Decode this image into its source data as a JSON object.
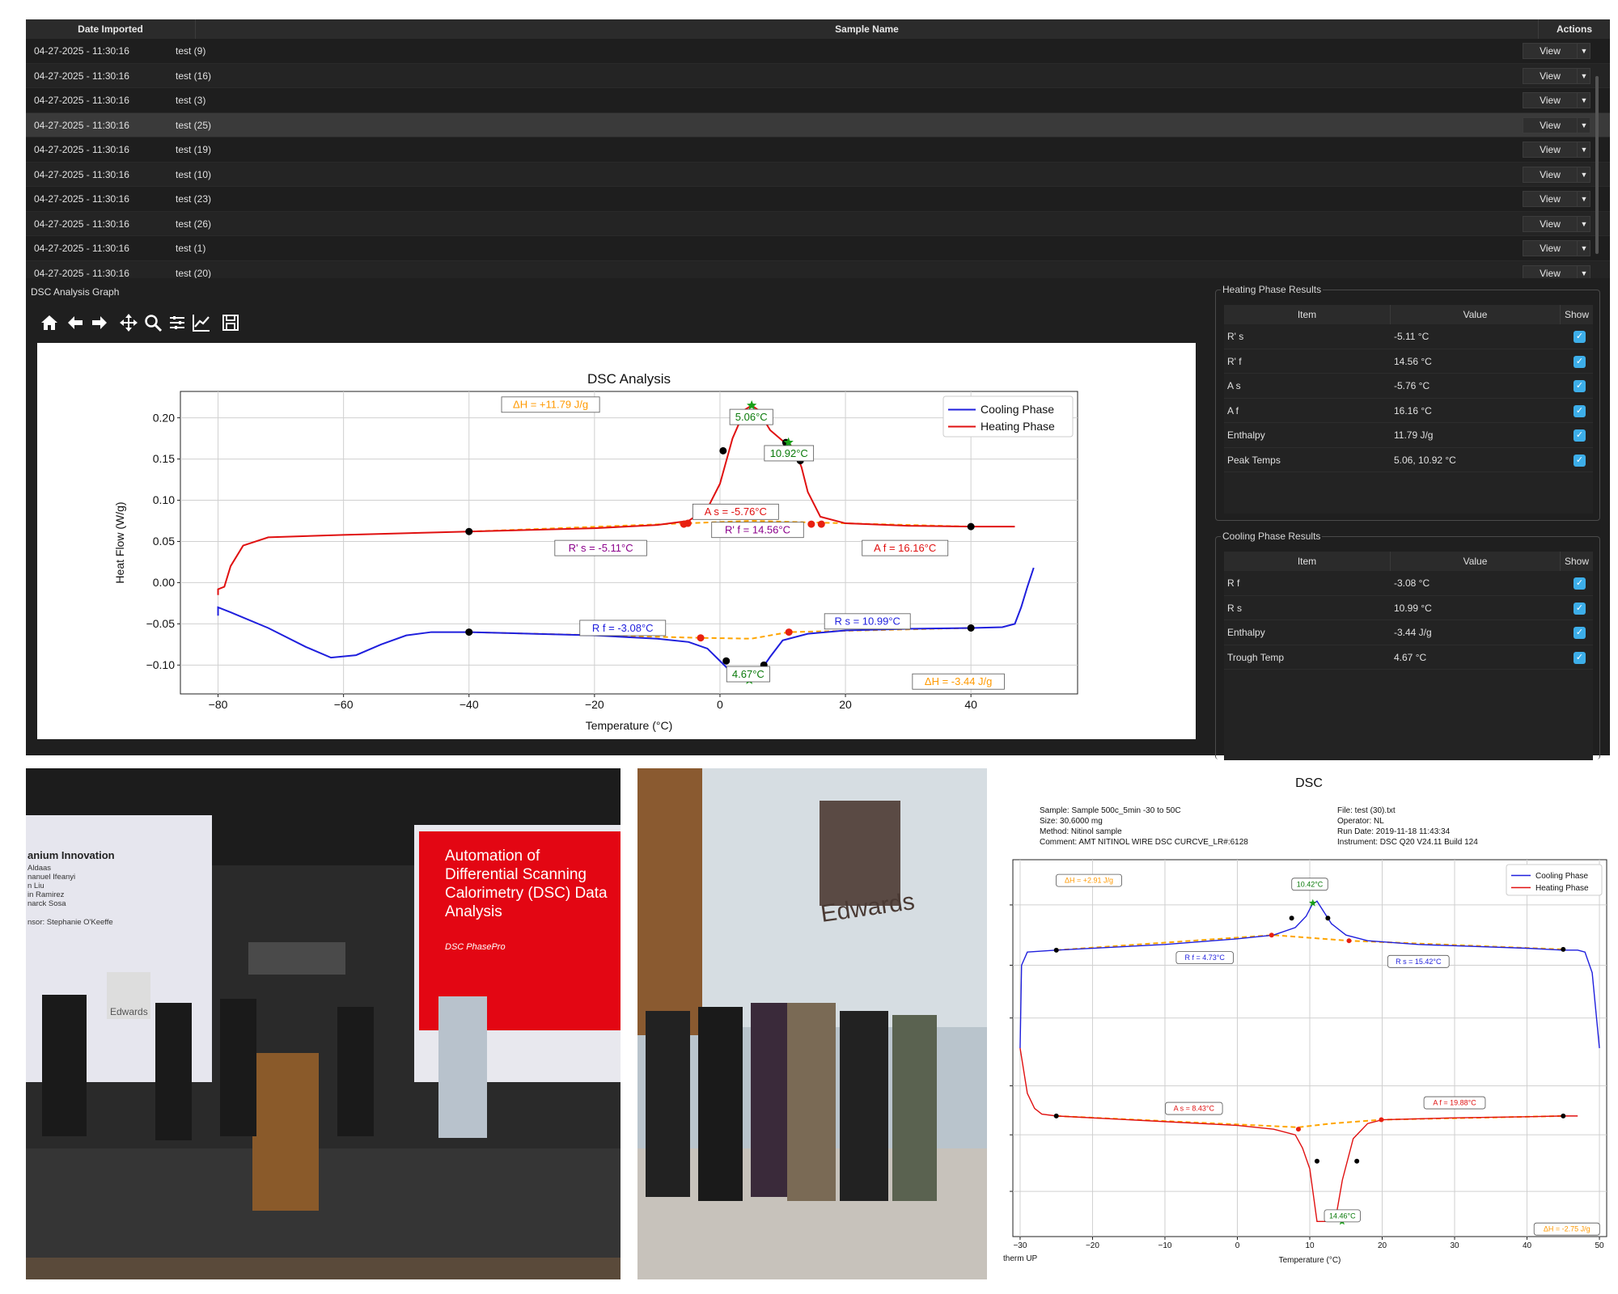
{
  "table": {
    "headers": [
      "Date Imported",
      "Sample Name",
      "Actions"
    ],
    "rows": [
      {
        "date": "04-27-2025 - 11:30:16",
        "name": "test (9)",
        "action": "View"
      },
      {
        "date": "04-27-2025 - 11:30:16",
        "name": "test (16)",
        "action": "View"
      },
      {
        "date": "04-27-2025 - 11:30:16",
        "name": "test (3)",
        "action": "View"
      },
      {
        "date": "04-27-2025 - 11:30:16",
        "name": "test (25)",
        "action": "View"
      },
      {
        "date": "04-27-2025 - 11:30:16",
        "name": "test (19)",
        "action": "View"
      },
      {
        "date": "04-27-2025 - 11:30:16",
        "name": "test (10)",
        "action": "View"
      },
      {
        "date": "04-27-2025 - 11:30:16",
        "name": "test (23)",
        "action": "View"
      },
      {
        "date": "04-27-2025 - 11:30:16",
        "name": "test (26)",
        "action": "View"
      },
      {
        "date": "04-27-2025 - 11:30:16",
        "name": "test (1)",
        "action": "View"
      },
      {
        "date": "04-27-2025 - 11:30:16",
        "name": "test (20)",
        "action": "View"
      }
    ],
    "selected_row": "test (25)"
  },
  "graph_panel_title": "DSC Analysis Graph",
  "toolbar": [
    "home-icon",
    "back-icon",
    "forward-icon",
    "pan-icon",
    "zoom-icon",
    "configure-subplots-icon",
    "edit-axis-icon",
    "save-icon"
  ],
  "heating_results": {
    "title": "Heating Phase Results",
    "headers": [
      "Item",
      "Value",
      "Show"
    ],
    "rows": [
      {
        "item": "R' s",
        "value": "-5.11 °C"
      },
      {
        "item": "R' f",
        "value": "14.56 °C"
      },
      {
        "item": "A s",
        "value": "-5.76 °C"
      },
      {
        "item": "A f",
        "value": "16.16 °C"
      },
      {
        "item": "Enthalpy",
        "value": "11.79 J/g"
      },
      {
        "item": "Peak Temps",
        "value": "5.06, 10.92 °C"
      }
    ]
  },
  "cooling_results": {
    "title": "Cooling Phase Results",
    "headers": [
      "Item",
      "Value",
      "Show"
    ],
    "rows": [
      {
        "item": "R f",
        "value": "-3.08 °C"
      },
      {
        "item": "R s",
        "value": "10.99 °C"
      },
      {
        "item": "Enthalpy",
        "value": "-3.44 J/g"
      },
      {
        "item": "Trough Temp",
        "value": "4.67 °C"
      }
    ]
  },
  "chart_data": [
    {
      "type": "line",
      "title": "DSC Analysis",
      "xlabel": "Temperature (°C)",
      "ylabel": "Heat Flow (W/g)",
      "xlim": [
        -86,
        57
      ],
      "ylim": [
        -0.135,
        0.232
      ],
      "xticks": [
        -80,
        -60,
        -40,
        -20,
        0,
        20,
        40
      ],
      "yticks": [
        0.2,
        0.15,
        0.1,
        0.05,
        0.0,
        -0.05,
        -0.1
      ],
      "ytick_labels": [
        "0.20",
        "0.15",
        "0.10",
        "0.05",
        "0.00",
        "−0.05",
        "−0.10"
      ],
      "xtick_labels": [
        "−80",
        "−60",
        "−40",
        "−20",
        "0",
        "20",
        "40"
      ],
      "grid": true,
      "legend_position": "top-right",
      "series": [
        {
          "name": "Cooling Phase",
          "color": "#1f1fdd",
          "x": [
            -80,
            -80,
            -78,
            -72,
            -66,
            -62,
            -58,
            -54,
            -50,
            -46,
            -40,
            -30,
            -20,
            -10,
            -5,
            -2,
            0,
            2,
            4,
            4.67,
            6,
            8,
            10,
            14,
            20,
            30,
            40,
            45,
            47,
            48,
            49,
            50
          ],
          "y": [
            -0.04,
            -0.03,
            -0.036,
            -0.055,
            -0.078,
            -0.091,
            -0.088,
            -0.075,
            -0.064,
            -0.06,
            -0.06,
            -0.062,
            -0.064,
            -0.068,
            -0.072,
            -0.08,
            -0.095,
            -0.11,
            -0.117,
            -0.118,
            -0.112,
            -0.09,
            -0.07,
            -0.062,
            -0.058,
            -0.056,
            -0.055,
            -0.054,
            -0.05,
            -0.03,
            -0.005,
            0.018
          ]
        },
        {
          "name": "Heating Phase",
          "color": "#e01010",
          "x": [
            -80,
            -80,
            -79,
            -78,
            -76,
            -72,
            -60,
            -40,
            -20,
            -10,
            -5,
            -2,
            0,
            2,
            4,
            5.06,
            6,
            8,
            10,
            10.92,
            12,
            13,
            14,
            16,
            20,
            30,
            40,
            47
          ],
          "y": [
            -0.015,
            -0.008,
            -0.005,
            0.02,
            0.045,
            0.055,
            0.058,
            0.062,
            0.066,
            0.07,
            0.075,
            0.09,
            0.12,
            0.175,
            0.21,
            0.215,
            0.21,
            0.185,
            0.172,
            0.17,
            0.16,
            0.14,
            0.11,
            0.08,
            0.072,
            0.069,
            0.068,
            0.068
          ]
        }
      ],
      "baselines": [
        {
          "x": [
            -40,
            5,
            40
          ],
          "y": [
            0.062,
            0.075,
            0.068
          ],
          "color": "#ffa500"
        },
        {
          "x": [
            -40,
            -3.08,
            5,
            10.99,
            40
          ],
          "y": [
            -0.06,
            -0.067,
            -0.068,
            -0.06,
            -0.055
          ],
          "color": "#ffa500"
        }
      ],
      "markers_black": [
        [
          -40,
          0.062
        ],
        [
          40,
          0.068
        ],
        [
          0.5,
          0.16
        ],
        [
          12.8,
          0.148
        ],
        [
          10.5,
          0.17
        ],
        [
          -40,
          -0.06
        ],
        [
          40,
          -0.055
        ],
        [
          1,
          -0.095
        ],
        [
          7,
          -0.1
        ]
      ],
      "markers_red": [
        [
          -5.76,
          0.071
        ],
        [
          -5.11,
          0.072
        ],
        [
          14.56,
          0.071
        ],
        [
          16.16,
          0.071
        ],
        [
          -3.08,
          -0.067
        ],
        [
          10.99,
          -0.06
        ]
      ],
      "markers_green": [
        [
          5.06,
          0.215
        ],
        [
          10.92,
          0.17
        ],
        [
          4.67,
          -0.118
        ]
      ],
      "annotations": [
        {
          "text": "ΔH = +11.79 J/g",
          "x": -27,
          "y": 0.216,
          "color": "#ff9900"
        },
        {
          "text": "5.06°C",
          "x": 5,
          "y": 0.201,
          "color": "#0a7a0a"
        },
        {
          "text": "10.92°C",
          "x": 11,
          "y": 0.157,
          "color": "#0a7a0a"
        },
        {
          "text": "A s = -5.76°C",
          "x": 2.5,
          "y": 0.086,
          "color": "#e01010"
        },
        {
          "text": "R' f = 14.56°C",
          "x": 6,
          "y": 0.064,
          "color": "#8b008b"
        },
        {
          "text": "R' s = -5.11°C",
          "x": -19,
          "y": 0.042,
          "color": "#8b008b"
        },
        {
          "text": "A f = 16.16°C",
          "x": 29.5,
          "y": 0.042,
          "color": "#e01010"
        },
        {
          "text": "R f = -3.08°C",
          "x": -15.5,
          "y": -0.055,
          "color": "#1f1fdd"
        },
        {
          "text": "R s = 10.99°C",
          "x": 23.5,
          "y": -0.047,
          "color": "#1f1fdd"
        },
        {
          "text": "4.67°C",
          "x": 4.5,
          "y": -0.111,
          "color": "#0a7a0a"
        },
        {
          "text": "ΔH = -3.44 J/g",
          "x": 38,
          "y": -0.12,
          "color": "#ff9900"
        }
      ]
    },
    {
      "type": "line",
      "title": "DSC",
      "xlabel": "Temperature (°C)",
      "xlim": [
        -31,
        51
      ],
      "xticks": [
        -30,
        -20,
        -10,
        0,
        10,
        20,
        30,
        40,
        50
      ],
      "xtick_labels": [
        "−30",
        "−20",
        "−10",
        "0",
        "10",
        "20",
        "30",
        "40",
        "50"
      ],
      "ylim": [
        0,
        1
      ],
      "grid": true,
      "legend_position": "top-right",
      "series": [
        {
          "name": "Cooling Phase",
          "color": "#1f1fdd",
          "x": [
            -30,
            -29.8,
            -29,
            -25,
            -10,
            0,
            5,
            8,
            9.5,
            10.3,
            11,
            12,
            13,
            15,
            18,
            25,
            40,
            45,
            47,
            48,
            49,
            49.5,
            50
          ],
          "y": [
            0.5,
            0.72,
            0.755,
            0.76,
            0.775,
            0.79,
            0.8,
            0.82,
            0.85,
            0.88,
            0.89,
            0.86,
            0.83,
            0.8,
            0.785,
            0.775,
            0.765,
            0.76,
            0.76,
            0.755,
            0.7,
            0.6,
            0.5
          ]
        },
        {
          "name": "Heating Phase",
          "color": "#e01010",
          "x": [
            -30,
            -29,
            -28,
            -27,
            -25,
            -10,
            0,
            5,
            8,
            9,
            10,
            11,
            13.5,
            14.5,
            16,
            18,
            20,
            30,
            40,
            45,
            47
          ],
          "y": [
            0.5,
            0.38,
            0.34,
            0.325,
            0.32,
            0.305,
            0.295,
            0.285,
            0.27,
            0.235,
            0.18,
            0.04,
            0.04,
            0.15,
            0.26,
            0.3,
            0.31,
            0.315,
            0.318,
            0.32,
            0.32
          ]
        }
      ],
      "baselines": [
        {
          "x": [
            -25,
            5,
            15.42,
            45
          ],
          "y": [
            0.76,
            0.8,
            0.785,
            0.762
          ],
          "color": "#ffa500"
        },
        {
          "x": [
            -25,
            8.43,
            13,
            19.88,
            45
          ],
          "y": [
            0.32,
            0.29,
            0.3,
            0.31,
            0.32
          ],
          "color": "#ffa500"
        }
      ],
      "markers_black": [
        [
          -25,
          0.76
        ],
        [
          45,
          0.762
        ],
        [
          7.5,
          0.845
        ],
        [
          12.5,
          0.845
        ],
        [
          -25,
          0.32
        ],
        [
          45,
          0.32
        ],
        [
          11,
          0.2
        ],
        [
          16.5,
          0.2
        ]
      ],
      "markers_red": [
        [
          4.73,
          0.8
        ],
        [
          15.42,
          0.785
        ],
        [
          8.43,
          0.285
        ],
        [
          19.88,
          0.31
        ]
      ],
      "markers_green": [
        [
          10.42,
          0.885
        ],
        [
          14.46,
          0.04
        ]
      ],
      "annotations": [
        {
          "text": "ΔH = +2.91 J/g",
          "x": -20.5,
          "y": 0.945,
          "color": "#ff9900"
        },
        {
          "text": "10.42°C",
          "x": 10,
          "y": 0.935,
          "color": "#0a7a0a"
        },
        {
          "text": "R f = 4.73°C",
          "x": -4.5,
          "y": 0.74,
          "color": "#1f1fdd"
        },
        {
          "text": "R s = 15.42°C",
          "x": 25,
          "y": 0.73,
          "color": "#1f1fdd"
        },
        {
          "text": "A s = 8.43°C",
          "x": -6,
          "y": 0.34,
          "color": "#e01010"
        },
        {
          "text": "A f = 19.88°C",
          "x": 30,
          "y": 0.355,
          "color": "#e01010"
        },
        {
          "text": "14.46°C",
          "x": 14.5,
          "y": 0.055,
          "color": "#0a7a0a"
        },
        {
          "text": "ΔH = -2.75 J/g",
          "x": 45.5,
          "y": 0.02,
          "color": "#ff9900"
        }
      ]
    }
  ],
  "report": {
    "title": "DSC",
    "sample": "Sample: Sample 500c_5min -30 to 50C",
    "size": "Size: 30.6000 mg",
    "method": "Method: Nitinol sample",
    "comment": "Comment: AMT NITINOL WIRE DSC CURCVE_LR#:6128",
    "file": "File: test (30).txt",
    "operator": "Operator: NL",
    "run_date": "Run Date: 2019-11-18 11:43:34",
    "instrument": "Instrument: DSC Q20 V24.11 Build 124",
    "corner_label": "therm UP"
  },
  "slide": {
    "left_title": "anium Innovation",
    "names": [
      "Aldaas",
      "nanuel Ifeanyi",
      "n Liu",
      "in Ramirez",
      "narck Sosa"
    ],
    "sponsor": "nsor: Stephanie O'Keeffe",
    "right_title": "Automation of Differential Scanning Calorimetry (DSC) Data Analysis",
    "right_subtitle": "DSC PhasePro",
    "logo_text": "Edwards"
  },
  "lobby_sign": "Edwards",
  "colors": {
    "app_bg": "#1f1f1f",
    "accent_check": "#3daee9",
    "slide_red": "#e30613"
  }
}
